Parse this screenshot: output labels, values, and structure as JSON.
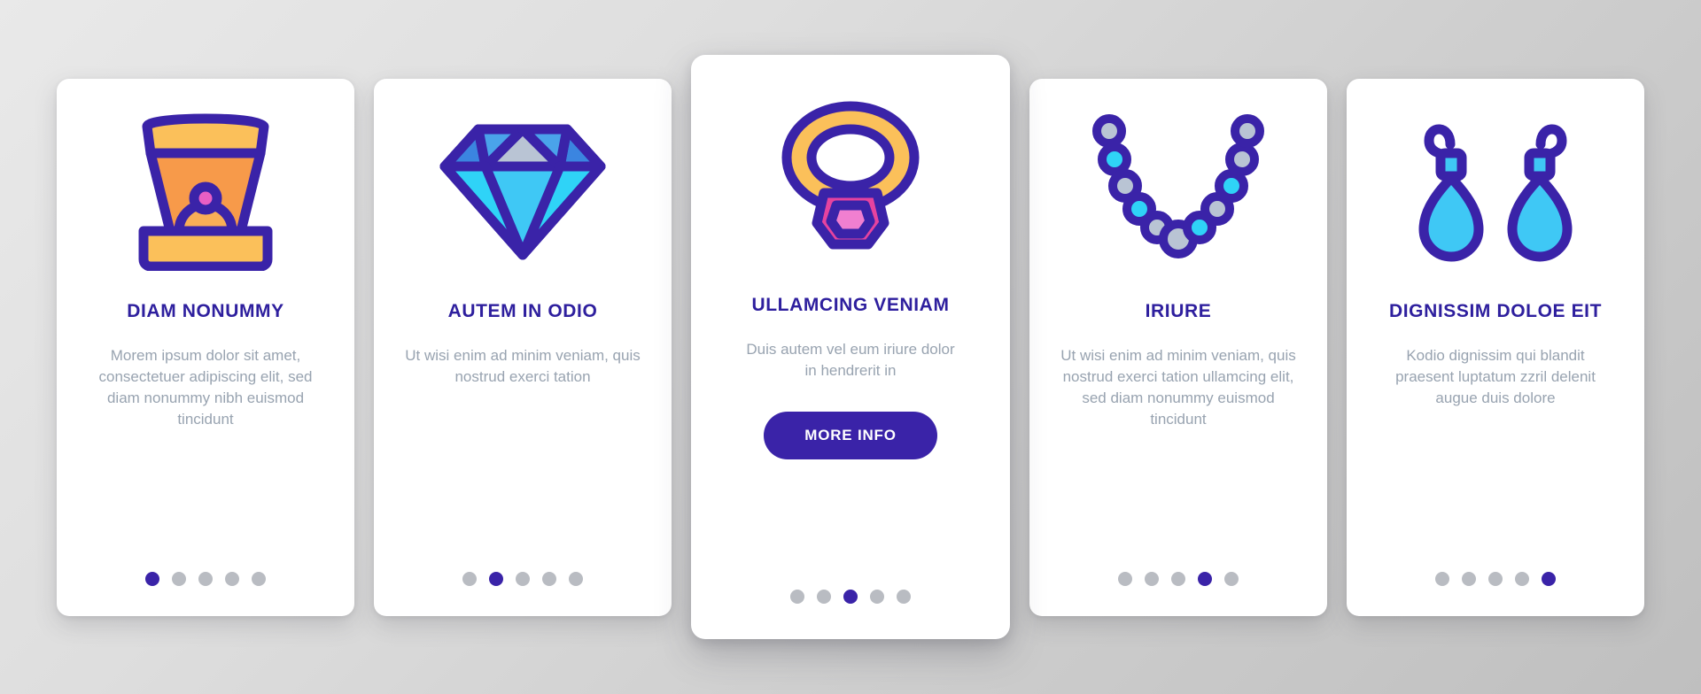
{
  "background": {
    "color_light": "#e9e9e9",
    "color_dark": "#bfbfbf"
  },
  "theme": {
    "title_color": "#2e1f9e",
    "body_color": "#98a3b0",
    "accent": "#3a23a8",
    "dot_inactive": "#b9bcc2",
    "card_background": "#ffffff"
  },
  "cards": [
    {
      "icon": "ring-box-icon",
      "title": "DIAM NONUMMY",
      "body": "Morem ipsum dolor sit amet, consectetuer adipiscing elit, sed diam nonummy nibh euismod tincidunt",
      "featured": false,
      "dots": {
        "count": 5,
        "active": 1
      },
      "cta": null
    },
    {
      "icon": "diamond-icon",
      "title": "AUTEM IN ODIO",
      "body": "Ut wisi enim ad minim veniam, quis nostrud exerci tation",
      "featured": false,
      "dots": {
        "count": 5,
        "active": 2
      },
      "cta": null
    },
    {
      "icon": "gemstone-ring-icon",
      "title": "ULLAMCING VENIAM",
      "body": "Duis autem vel eum iriure dolor in hendrerit in",
      "featured": true,
      "dots": {
        "count": 5,
        "active": 3
      },
      "cta": "MORE INFO"
    },
    {
      "icon": "pearl-necklace-icon",
      "title": "IRIURE",
      "body": "Ut wisi enim ad minim veniam, quis nostrud exerci tation ullamcing elit, sed diam nonummy euismod tincidunt",
      "featured": false,
      "dots": {
        "count": 5,
        "active": 4
      },
      "cta": null
    },
    {
      "icon": "earrings-icon",
      "title": "DIGNISSIM DOLOE EIT",
      "body": "Kodio dignissim qui blandit praesent luptatum zzril delenit augue duis dolore",
      "featured": false,
      "dots": {
        "count": 5,
        "active": 5
      },
      "cta": null
    }
  ]
}
